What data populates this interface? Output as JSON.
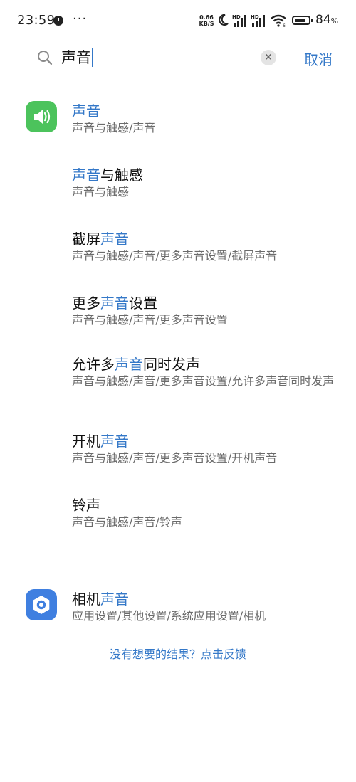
{
  "status_bar": {
    "time": "23:59",
    "more": "···",
    "net_speed_value": "0.66",
    "net_speed_unit": "KB/S",
    "signal1_label": "HD",
    "signal2_label": "HD",
    "battery_value": "84",
    "battery_unit": "%",
    "battery_level": 0.84
  },
  "search": {
    "query": "声音",
    "clear_icon": "×",
    "cancel_label": "取消"
  },
  "results": [
    {
      "icon": "speaker-icon",
      "title_pre": "",
      "title_hl": "声音",
      "title_post": "",
      "path": "声音与触感/声音"
    },
    {
      "icon": null,
      "title_pre": "",
      "title_hl": "声音",
      "title_post": "与触感",
      "path": "声音与触感"
    },
    {
      "icon": null,
      "title_pre": "截屏",
      "title_hl": "声音",
      "title_post": "",
      "path": "声音与触感/声音/更多声音设置/截屏声音"
    },
    {
      "icon": null,
      "title_pre": "更多",
      "title_hl": "声音",
      "title_post": "设置",
      "path": "声音与触感/声音/更多声音设置"
    },
    {
      "icon": null,
      "title_pre": "允许多",
      "title_hl": "声音",
      "title_post": "同时发声",
      "path": "声音与触感/声音/更多声音设置/允许多声音同时发声"
    },
    {
      "icon": null,
      "title_pre": "开机",
      "title_hl": "声音",
      "title_post": "",
      "path": "声音与触感/声音/更多声音设置/开机声音"
    },
    {
      "icon": null,
      "title_pre": "铃声",
      "title_hl": "",
      "title_post": "",
      "path": "声音与触感/声音/铃声"
    }
  ],
  "app_result": {
    "icon": "camera-app-icon",
    "title_pre": "相机",
    "title_hl": "声音",
    "title_post": "",
    "path": "应用设置/其他设置/系统应用设置/相机"
  },
  "feedback_link": "没有想要的结果？点击反馈",
  "colors": {
    "accent": "#3478c8",
    "speaker_icon_bg": "#4cc35c",
    "camera_icon_bg": "#3f7fe0"
  }
}
